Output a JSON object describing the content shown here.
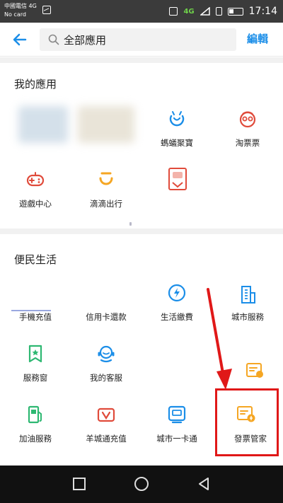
{
  "status_bar": {
    "carrier_line1": "中國電信 4G",
    "carrier_line2": "No card",
    "network": "4G",
    "time": "17:14"
  },
  "header": {
    "search_text": "全部應用",
    "edit_label": "編輯"
  },
  "my_apps": {
    "title": "我的應用",
    "items": [
      {
        "label": "",
        "icon": "blurred-app-icon"
      },
      {
        "label": "",
        "icon": "blurred-app-icon"
      },
      {
        "label": "螞蟻聚寶",
        "icon": "ant-fortune-icon"
      },
      {
        "label": "淘票票",
        "icon": "tao-ticket-icon"
      },
      {
        "label": "遊戲中心",
        "icon": "gamepad-icon"
      },
      {
        "label": "滴滴出行",
        "icon": "didi-icon"
      },
      {
        "label": "",
        "icon": "red-app-icon"
      }
    ]
  },
  "convenience": {
    "title": "便民生活",
    "items": [
      {
        "label": "手機充值",
        "icon": "phone-recharge-icon"
      },
      {
        "label": "信用卡還款",
        "icon": "credit-card-icon"
      },
      {
        "label": "生活繳費",
        "icon": "utility-drop-icon"
      },
      {
        "label": "城市服務",
        "icon": "city-building-icon"
      },
      {
        "label": "服務窗",
        "icon": "service-window-icon"
      },
      {
        "label": "我的客服",
        "icon": "customer-service-icon"
      },
      {
        "label": "",
        "icon": "invoice-icon"
      },
      {
        "label": "加油服務",
        "icon": "fuel-pump-icon"
      },
      {
        "label": "羊城通充值",
        "icon": "yct-card-icon"
      },
      {
        "label": "城市一卡通",
        "icon": "city-card-icon"
      },
      {
        "label": "發票管家",
        "icon": "invoice-manager-icon"
      }
    ]
  },
  "colors": {
    "accent_blue": "#1b8ee8",
    "orange": "#f5a623",
    "red": "#e04b3b",
    "green": "#2eb872",
    "highlight_red": "#e01818"
  }
}
